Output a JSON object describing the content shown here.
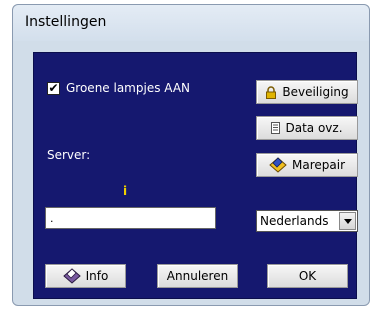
{
  "window": {
    "title": "Instellingen"
  },
  "options": {
    "green_lights_label": "Groene lampjes AAN",
    "green_lights_checked": true
  },
  "server": {
    "label": "Server:",
    "info_marker": "i",
    "value": "."
  },
  "buttons": {
    "security": "Beveiliging",
    "data_overview": "Data ovz.",
    "marepair": "Marepair",
    "info": "Info",
    "cancel": "Annuleren",
    "ok": "OK"
  },
  "language": {
    "selected": "Nederlands"
  },
  "icons": {
    "security": "lock-icon",
    "data_overview": "document-icon",
    "marepair": "tools-icon",
    "info": "info-tools-icon",
    "dropdown": "chevron-down-icon"
  },
  "colors": {
    "panel_background": "#15186f",
    "window_background": "#d1dde9",
    "info_marker": "#f0d000"
  }
}
